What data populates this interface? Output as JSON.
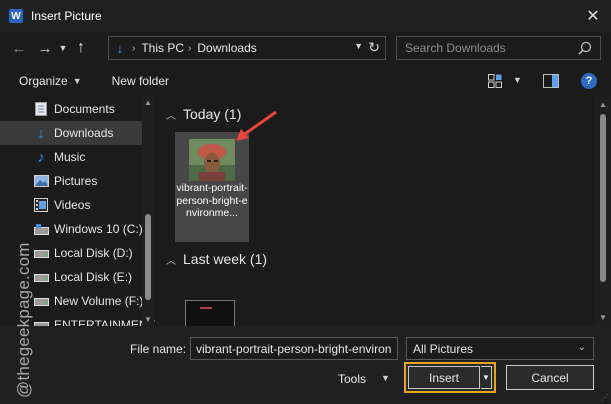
{
  "window": {
    "title": "Insert Picture",
    "app_icon": "W"
  },
  "address": {
    "crumbs": [
      "This PC",
      "Downloads"
    ]
  },
  "search": {
    "placeholder": "Search Downloads"
  },
  "toolbar": {
    "organize": "Organize",
    "new_folder": "New folder"
  },
  "nav_pane": {
    "items": [
      {
        "label": "Documents",
        "icon": "documents-icon",
        "selected": false
      },
      {
        "label": "Downloads",
        "icon": "downloads-icon",
        "selected": true
      },
      {
        "label": "Music",
        "icon": "music-icon",
        "selected": false
      },
      {
        "label": "Pictures",
        "icon": "pictures-icon",
        "selected": false
      },
      {
        "label": "Videos",
        "icon": "videos-icon",
        "selected": false
      },
      {
        "label": "Windows 10 (C:)",
        "icon": "drive-icon",
        "selected": false
      },
      {
        "label": "Local Disk (D:)",
        "icon": "drive-icon",
        "selected": false
      },
      {
        "label": "Local Disk (E:)",
        "icon": "drive-icon",
        "selected": false
      },
      {
        "label": "New Volume (F:)",
        "icon": "drive-icon",
        "selected": false
      },
      {
        "label": "ENTERTAINMENT",
        "icon": "drive-icon",
        "selected": false
      }
    ]
  },
  "groups": [
    {
      "label": "Today (1)",
      "files": [
        {
          "name": "vibrant-portrait-person-bright-environme..."
        }
      ]
    },
    {
      "label": "Last week (1)"
    }
  ],
  "footer": {
    "file_name_label": "File name:",
    "file_name_value": "vibrant-portrait-person-bright-environment",
    "filter_value": "All Pictures",
    "tools_label": "Tools",
    "insert_label": "Insert",
    "cancel_label": "Cancel"
  },
  "watermark": {
    "text": "@thegeekpage.com"
  },
  "colors": {
    "accent": "#e8a51c",
    "arrow": "#e8453c",
    "folder_blue": "#3c8ee8"
  }
}
